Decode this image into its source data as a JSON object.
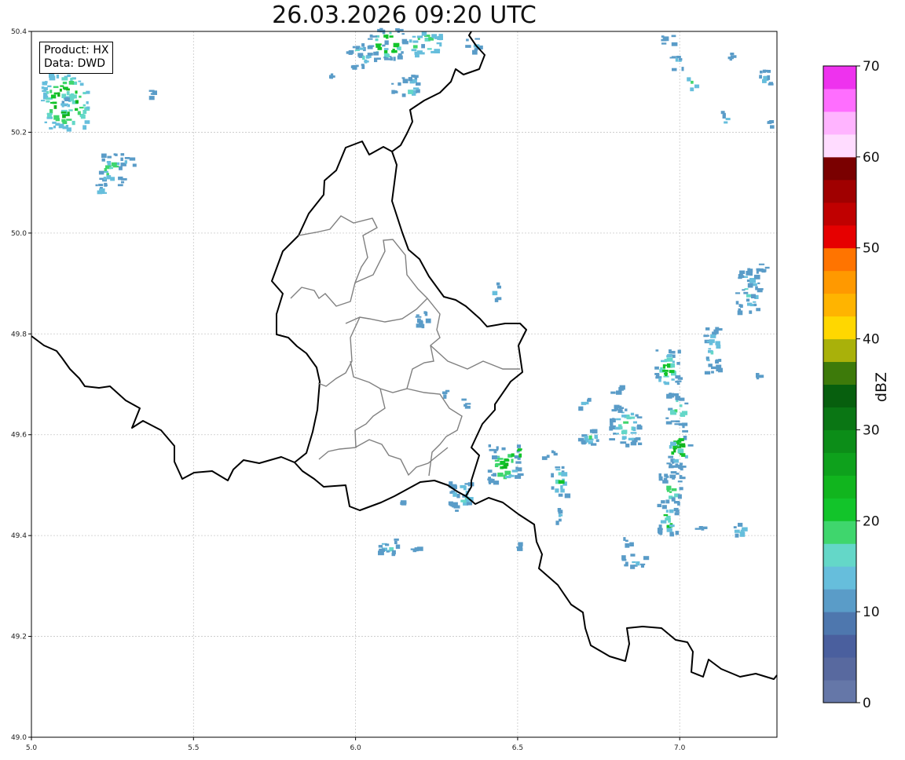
{
  "title": "26.03.2026 09:20 UTC",
  "info": {
    "product": "Product: HX",
    "data": "Data: DWD"
  },
  "colorbar": {
    "label": "dBZ",
    "ticks": [
      "0",
      "10",
      "20",
      "30",
      "40",
      "50",
      "60",
      "70"
    ],
    "min": 0,
    "max": 70,
    "step": 2.5,
    "colors": [
      "#6577a8",
      "#58699f",
      "#4a5f9e",
      "#4e77ae",
      "#5a9cc8",
      "#66bedc",
      "#64d7c8",
      "#3fd66d",
      "#12c42a",
      "#11b51e",
      "#0ea11c",
      "#0c8d18",
      "#0a7614",
      "#075f0e",
      "#3d7a0a",
      "#a9b10a",
      "#ffd700",
      "#ffb400",
      "#ff9900",
      "#ff7400",
      "#e60000",
      "#c00000",
      "#a00000",
      "#7a0000",
      "#ffdcff",
      "#ffb4ff",
      "#ff6eff",
      "#ee32ee"
    ]
  },
  "axes": {
    "x_ticks": [
      "5.0",
      "5.5",
      "6.0",
      "6.5",
      "7.0"
    ],
    "x_values": [
      5.0,
      5.5,
      6.0,
      6.5,
      7.0
    ],
    "y_ticks": [
      "50.4",
      "50.2",
      "50.0",
      "49.8",
      "49.6",
      "49.4",
      "49.2",
      "49.0"
    ],
    "y_values": [
      50.4,
      50.2,
      50.0,
      49.8,
      49.6,
      49.4,
      49.2,
      49.0
    ],
    "lon_range": [
      5.0,
      7.3
    ],
    "lat_range": [
      49.0,
      50.4
    ],
    "grid": true
  }
}
